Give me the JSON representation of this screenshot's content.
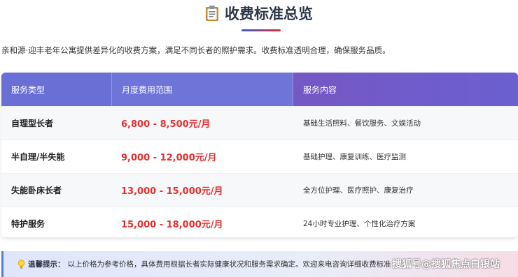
{
  "title": "收费标准总览",
  "intro": "亲和源·迎丰老年公寓提供差异化的收费方案，满足不同长者的照护需求。收费标准透明合理，确保服务品质。",
  "table": {
    "headers": [
      "服务类型",
      "月度费用范围",
      "服务内容"
    ],
    "rows": [
      {
        "type": "自理型长者",
        "price": "6,800 - 8,500元/月",
        "services": "基础生活照料、餐饮服务、文娱活动"
      },
      {
        "type": "半自理/半失能",
        "price": "9,000 - 12,000元/月",
        "services": "基础护理、康复训练、医疗监测"
      },
      {
        "type": "失能卧床长者",
        "price": "13,000 - 15,000元/月",
        "services": "全方位护理、医疗照护、康复治疗"
      },
      {
        "type": "特护服务",
        "price": "15,000 - 18,000元/月",
        "services": "24小时专业护理、个性化治疗方案"
      }
    ]
  },
  "tip": {
    "label": "温馨提示：",
    "text": "以上价格为参考价格，具体费用根据长者实际健康状况和服务需求确定。欢迎来电咨询详细收费标准"
  },
  "watermark": "搜狐号@搜狐焦点白银站",
  "colors": {
    "accent": "#6a6fd6",
    "price": "#e03131"
  },
  "icons": {
    "title": "clipboard-icon",
    "tip": "lightbulb-icon"
  }
}
